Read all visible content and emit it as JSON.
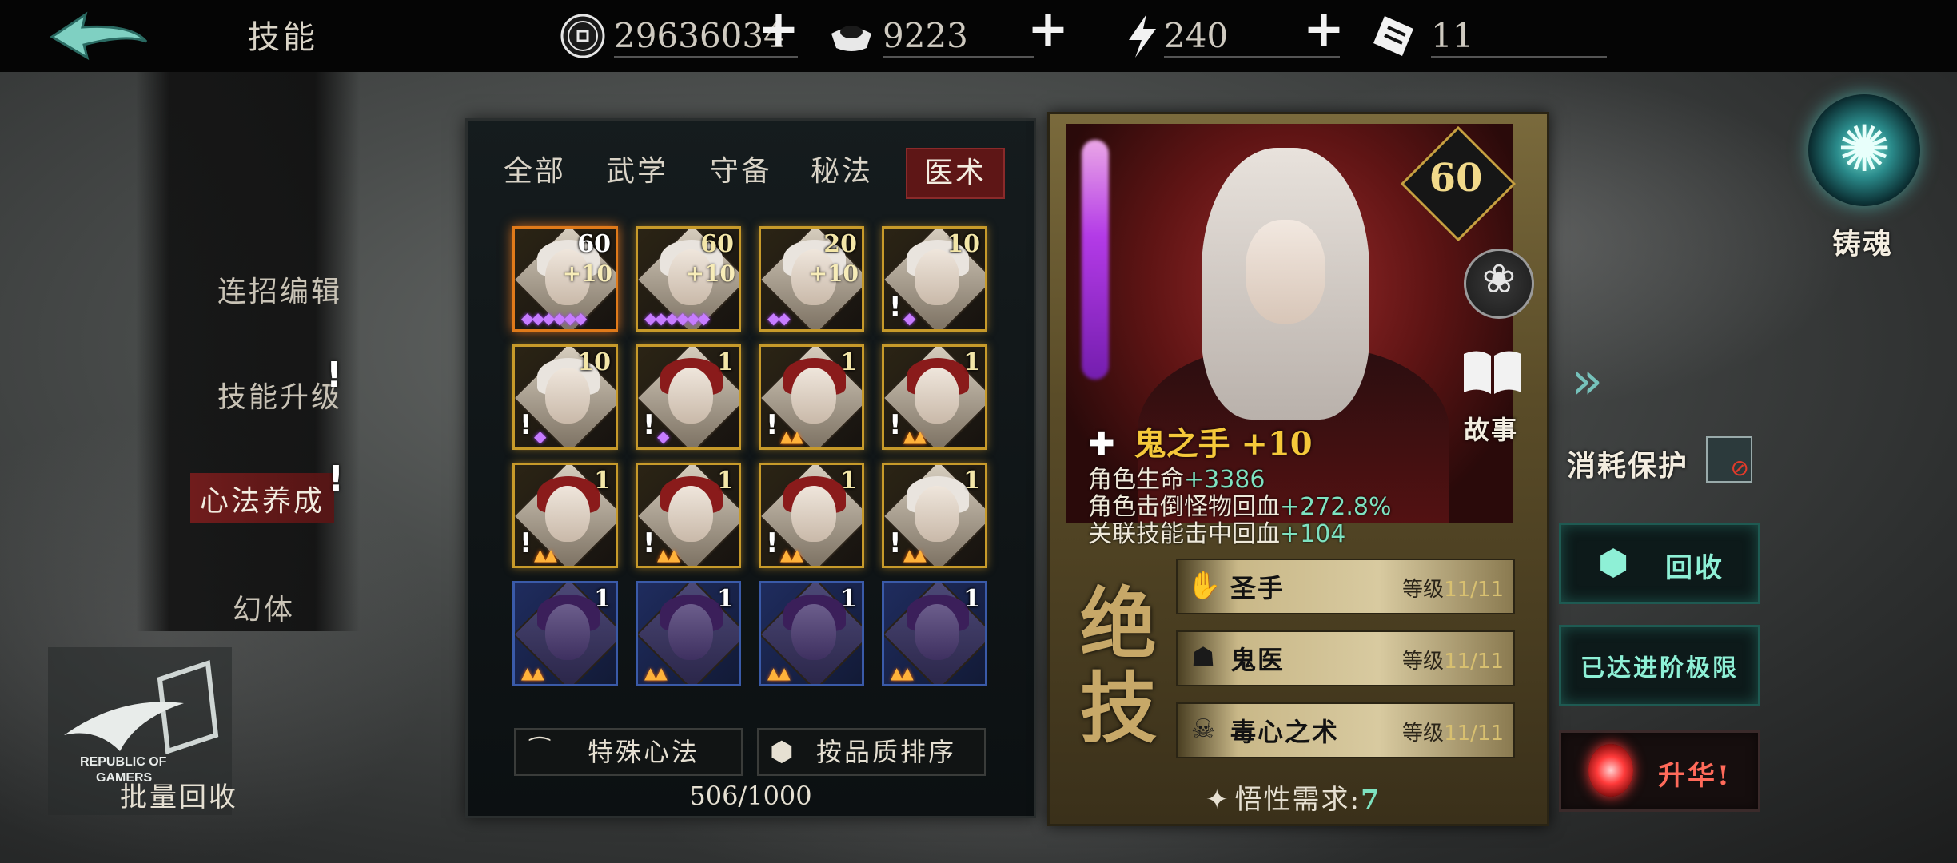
{
  "header": {
    "title": "技能",
    "currencies": [
      {
        "icon": "coin-icon",
        "value": "29636034"
      },
      {
        "icon": "ingot-icon",
        "value": "9223"
      },
      {
        "icon": "lightning-icon",
        "value": "240"
      },
      {
        "icon": "ticket-icon",
        "value": "11"
      }
    ]
  },
  "left_menu": {
    "items": [
      "连招编辑",
      "技能升级",
      "心法养成",
      "幻体"
    ],
    "active": "心法养成",
    "batch_recycle": "批量回收",
    "overlay_logo_text": "REPUBLIC OF GAMERS"
  },
  "inventory": {
    "tabs": [
      "全部",
      "武学",
      "守备",
      "秘法",
      "医术"
    ],
    "active_tab": "医术",
    "cards": [
      {
        "level": "60",
        "plus": "+10",
        "frame": "orange",
        "hair": "light",
        "gems": "◆◆◆◆◆◆",
        "gem_type": "purple",
        "excl": false
      },
      {
        "level": "60",
        "plus": "+10",
        "frame": "gold",
        "hair": "light",
        "gems": "◆◆◆◆◆◆",
        "gem_type": "purple",
        "excl": false
      },
      {
        "level": "20",
        "plus": "+10",
        "frame": "gold",
        "hair": "light",
        "gems": "◆◆",
        "gem_type": "purple",
        "excl": false
      },
      {
        "level": "10",
        "plus": "",
        "frame": "gold",
        "hair": "light",
        "gems": "◆",
        "gem_type": "purple",
        "excl": true
      },
      {
        "level": "10",
        "plus": "",
        "frame": "gold",
        "hair": "light",
        "gems": "◆",
        "gem_type": "purple",
        "excl": true
      },
      {
        "level": "1",
        "plus": "",
        "frame": "gold",
        "hair": "hood",
        "gems": "◆",
        "gem_type": "purple",
        "excl": true
      },
      {
        "level": "1",
        "plus": "",
        "frame": "gold",
        "hair": "hood",
        "gems": "▲▲",
        "gem_type": "fire",
        "excl": true
      },
      {
        "level": "1",
        "plus": "",
        "frame": "gold",
        "hair": "hood",
        "gems": "▲▲",
        "gem_type": "fire",
        "excl": true
      },
      {
        "level": "1",
        "plus": "",
        "frame": "gold",
        "hair": "hood",
        "gems": "▲▲",
        "gem_type": "fire",
        "excl": true
      },
      {
        "level": "1",
        "plus": "",
        "frame": "gold",
        "hair": "hood",
        "gems": "▲▲",
        "gem_type": "fire",
        "excl": true
      },
      {
        "level": "1",
        "plus": "",
        "frame": "gold",
        "hair": "hood",
        "gems": "▲▲",
        "gem_type": "fire",
        "excl": true
      },
      {
        "level": "1",
        "plus": "",
        "frame": "gold",
        "hair": "light",
        "gems": "▲▲",
        "gem_type": "fire",
        "excl": true
      },
      {
        "level": "1",
        "plus": "",
        "frame": "blue",
        "hair": "blue",
        "gems": "▲▲",
        "gem_type": "fire",
        "excl": false
      },
      {
        "level": "1",
        "plus": "",
        "frame": "blue",
        "hair": "blue",
        "gems": "▲▲",
        "gem_type": "fire",
        "excl": false
      },
      {
        "level": "1",
        "plus": "",
        "frame": "blue",
        "hair": "blue",
        "gems": "▲▲",
        "gem_type": "fire",
        "excl": false
      },
      {
        "level": "1",
        "plus": "",
        "frame": "blue",
        "hair": "blue",
        "gems": "▲▲",
        "gem_type": "fire",
        "excl": false
      }
    ],
    "special_button": "特殊心法",
    "sort_button": "按品质排序",
    "count": "506/1000"
  },
  "detail": {
    "level": "60",
    "story_label": "故事",
    "skill_name": "鬼之手",
    "skill_plus": "+10",
    "stats": [
      {
        "label": "角色生命",
        "value": "+3386"
      },
      {
        "label": "角色击倒怪物回血",
        "value": "+272.8%"
      },
      {
        "label": "关联技能击中回血",
        "value": "+104"
      }
    ],
    "ultimate_chars": [
      "绝",
      "技"
    ],
    "passives": [
      {
        "icon": "hand-icon",
        "glyph": "✋",
        "name": "圣手",
        "level_label": "等级",
        "level": "11/11"
      },
      {
        "icon": "hood-icon",
        "glyph": "☗",
        "name": "鬼医",
        "level_label": "等级",
        "level": "11/11"
      },
      {
        "icon": "poison-icon",
        "glyph": "☠",
        "name": "毒心之术",
        "level_label": "等级",
        "level": "11/11"
      }
    ],
    "insight_label": "悟性需求:",
    "insight_value": "7"
  },
  "right": {
    "forge_label": "铸魂",
    "consume_label": "消耗保护",
    "recycle_label": "回收",
    "max_advance_label": "已达进阶极限",
    "sublimate_label": "升华!"
  },
  "colors": {
    "accent_teal": "#8ef0d6",
    "gold": "#f5c83a",
    "active_tab_red": "#5e1616"
  }
}
